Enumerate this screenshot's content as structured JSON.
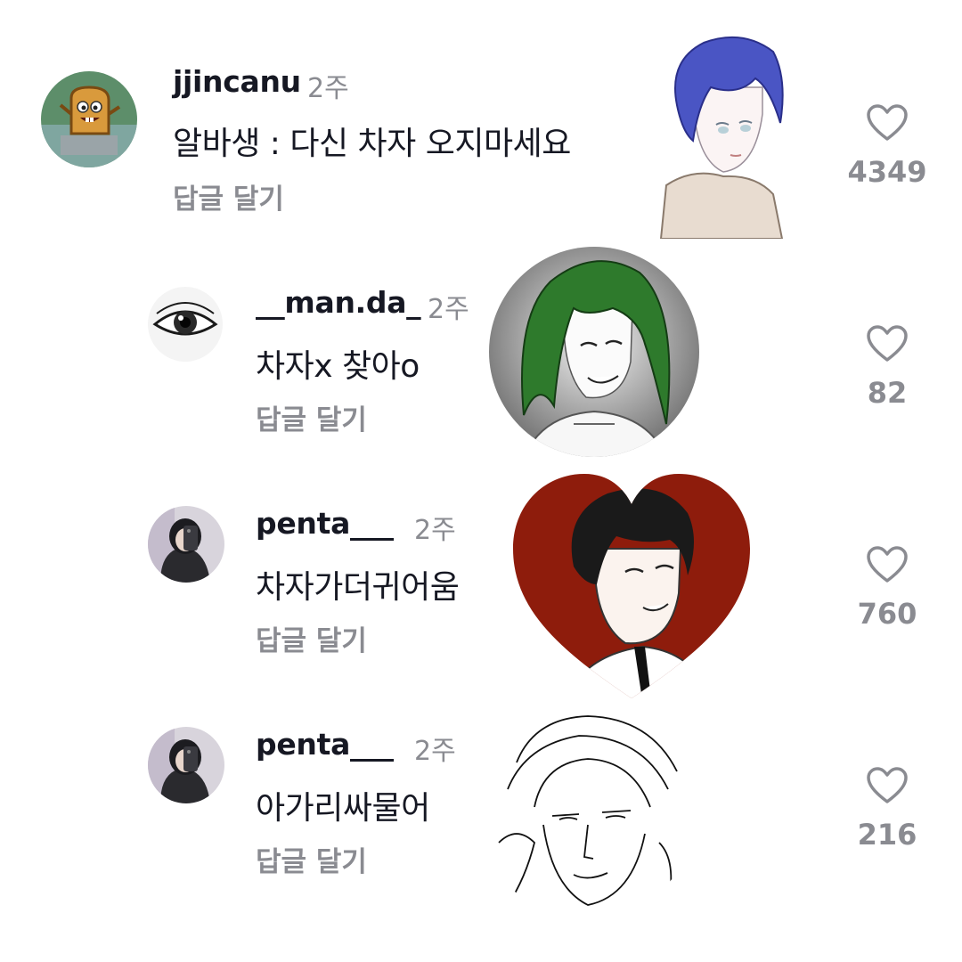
{
  "reply_label": "답글 달기",
  "comments": [
    {
      "username": "jjincanu",
      "time": "2주",
      "text": "알바생 : 다신 차자 오지마세요",
      "likes": "4349",
      "avatar_icon": "toast-cartoon-avatar",
      "sticker_icon": "blue-haired-character-sticker"
    },
    {
      "username": "__man.da_",
      "time": "2주",
      "text": "차자x 찾아o",
      "likes": "82",
      "avatar_icon": "eye-avatar",
      "sticker_icon": "green-haired-character-sticker"
    },
    {
      "username": "penta___",
      "time": "2주",
      "text": "차자가더귀어움",
      "likes": "760",
      "avatar_icon": "selfie-avatar",
      "sticker_icon": "heart-character-sticker"
    },
    {
      "username": "penta___",
      "time": "2주",
      "text": "아가리싸물어",
      "likes": "216",
      "avatar_icon": "selfie-avatar",
      "sticker_icon": "sketch-character-sticker"
    }
  ],
  "colors": {
    "text": "#161823",
    "muted": "#8a8b91",
    "heart_red": "#8e1c0c",
    "blue_hair": "#4a55c4",
    "green_hair": "#2e7a2c"
  }
}
